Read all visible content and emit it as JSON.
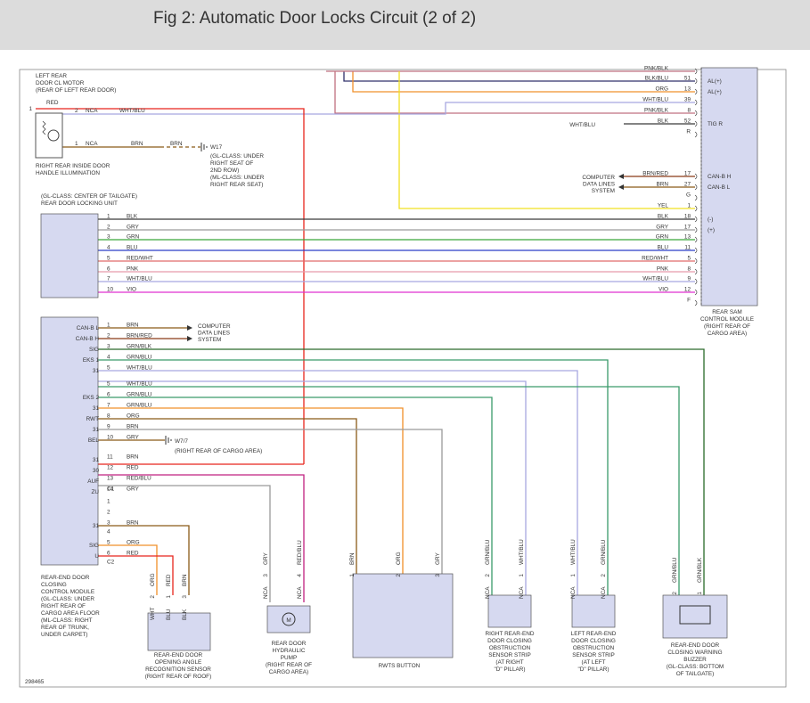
{
  "title": "Fig 2: Automatic Door Locks Circuit (2 of 2)",
  "diagram_id": "298465",
  "colors": {
    "RED": "#e8251c",
    "BLK": "#3a3a3a",
    "GRY": "#9a9a9a",
    "GRN": "#3aa83a",
    "BLU": "#2b3fc6",
    "PNK": "#e89aaa",
    "VIO": "#e030d0",
    "BRN": "#8a5a18",
    "ORG": "#f0902a",
    "YEL": "#f0e020",
    "WHT/BLU": "#a8a8e0",
    "RED/WHT": "#e06a6a",
    "RED/BLU": "#c02080",
    "GRN/BLU": "#3a9a6a",
    "GRN/BLK": "#2a6a2a",
    "BLK/BLU": "#30306a",
    "BRN/RED": "#8a3a18",
    "PNK/BLK": "#c07080"
  },
  "components": {
    "left_rear_motor": "LEFT REAR\nDOOR CL MOTOR\n(REAR OF LEFT REAR DOOR)",
    "handle_illum": "RIGHT REAR INSIDE DOOR\nHANDLE ILLUMINATION",
    "ground_w17": "W17",
    "ground_w17_desc": "(GL-CLASS: UNDER\nRIGHT SEAT OF\n2ND ROW)\n(ML-CLASS: UNDER\nRIGHT REAR SEAT)",
    "tailgate_unit": "(GL-CLASS: CENTER OF TAILGATE)\nREAR DOOR LOCKING UNIT",
    "closing_module": "REAR-END DOOR\nCLOSING\nCONTROL MODULE\n(GL-CLASS: UNDER\nRIGHT REAR OF\nCARGO AREA FLOOR\n(ML-CLASS: RIGHT\nREAR OF TRUNK,\nUNDER CARPET)",
    "angle_sensor": "REAR-END DOOR\nOPENING ANGLE\nRECOGNITION SENSOR\n(RIGHT REAR OF ROOF)",
    "pump": "REAR DOOR\nHYDRAULIC\nPUMP\n(RIGHT REAR OF\nCARGO AREA)",
    "rwts": "RWTS BUTTON",
    "right_strip": "RIGHT REAR-END\nDOOR CLOSING\nOBSTRUCTION\nSENSOR STRIP\n(AT RIGHT\n\"D\" PILLAR)",
    "left_strip": "LEFT REAR-END\nDOOR CLOSING\nOBSTRUCTION\nSENSOR STRIP\n(AT LEFT\n\"D\" PILLAR)",
    "buzzer": "REAR-END DOOR\nCLOSING WARNING\nBUZZER\n(GL-CLASS: BOTTOM\nOF TAILGATE)",
    "sam": "REAR SAM\nCONTROL MODULE\n(RIGHT REAR OF\nCARGO AREA)",
    "computer_lines": "COMPUTER\nDATA LINES\nSYSTEM",
    "ground_w77": "W7/7",
    "ground_w77_desc": "(RIGHT REAR OF CARGO AREA)"
  },
  "sam_pins": [
    {
      "wire": "PNK/BLK",
      "pin": "",
      "sig": ""
    },
    {
      "wire": "BLK/BLU",
      "pin": "51",
      "sig": "AL(+)"
    },
    {
      "wire": "ORG",
      "pin": "13",
      "sig": "AL(+)"
    },
    {
      "wire": "WHT/BLU",
      "pin": "39",
      "sig": ""
    },
    {
      "wire": "PNK/BLK",
      "pin": "8",
      "sig": ""
    },
    {
      "wire": "BLK",
      "pin": "52",
      "sig": "TIG R"
    },
    {
      "wire": "",
      "pin": "R",
      "sig": ""
    },
    {
      "wire": "BRN/RED",
      "pin": "17",
      "sig": "CAN-B H"
    },
    {
      "wire": "BRN",
      "pin": "27",
      "sig": "CAN-B L"
    },
    {
      "wire": "",
      "pin": "G",
      "sig": ""
    },
    {
      "wire": "YEL",
      "pin": "1",
      "sig": ""
    },
    {
      "wire": "BLK",
      "pin": "18",
      "sig": "(-)"
    },
    {
      "wire": "GRY",
      "pin": "17",
      "sig": "(+)"
    },
    {
      "wire": "GRN",
      "pin": "13",
      "sig": ""
    },
    {
      "wire": "BLU",
      "pin": "11",
      "sig": ""
    },
    {
      "wire": "RED/WHT",
      "pin": "5",
      "sig": ""
    },
    {
      "wire": "PNK",
      "pin": "8",
      "sig": ""
    },
    {
      "wire": "WHT/BLU",
      "pin": "9",
      "sig": ""
    },
    {
      "wire": "VIO",
      "pin": "12",
      "sig": ""
    },
    {
      "wire": "",
      "pin": "F",
      "sig": ""
    }
  ],
  "motor_wires": [
    {
      "pin": "1",
      "wire": "RED",
      "sig": ""
    },
    {
      "pin": "2",
      "wire": "WHT/BLU",
      "sig": "NCA"
    },
    {
      "pin": "1",
      "wire": "BRN",
      "sig": "NCA"
    }
  ],
  "tailgate_wires": [
    {
      "pin": "1",
      "wire": "BLK"
    },
    {
      "pin": "2",
      "wire": "GRY"
    },
    {
      "pin": "3",
      "wire": "GRN"
    },
    {
      "pin": "4",
      "wire": "BLU"
    },
    {
      "pin": "5",
      "wire": "RED/WHT"
    },
    {
      "pin": "6",
      "wire": "PNK"
    },
    {
      "pin": "7",
      "wire": "WHT/BLU"
    },
    {
      "pin": "10",
      "wire": "VIO"
    }
  ],
  "module_pins": [
    {
      "sig": "CAN-B L",
      "pin": "1",
      "wire": "BRN"
    },
    {
      "sig": "CAN-B H",
      "pin": "2",
      "wire": "BRN/RED"
    },
    {
      "sig": "SIG",
      "pin": "3",
      "wire": "GRN/BLK"
    },
    {
      "sig": "EKS 1",
      "pin": "4",
      "wire": "GRN/BLU"
    },
    {
      "sig": "31",
      "pin": "5",
      "wire": "WHT/BLU"
    },
    {
      "sig": "",
      "pin": "5",
      "wire": "WHT/BLU"
    },
    {
      "sig": "EKS 2",
      "pin": "6",
      "wire": "GRN/BLU"
    },
    {
      "sig": "31",
      "pin": "7",
      "wire": "GRN/BLU"
    },
    {
      "sig": "RWT",
      "pin": "8",
      "wire": "ORG"
    },
    {
      "sig": "31",
      "pin": "9",
      "wire": "BRN"
    },
    {
      "sig": "BEL",
      "pin": "10",
      "wire": "GRY"
    },
    {
      "sig": "31",
      "pin": "11",
      "wire": "BRN"
    },
    {
      "sig": "30",
      "pin": "12",
      "wire": "RED"
    },
    {
      "sig": "AUF",
      "pin": "13",
      "wire": "RED/BLU"
    },
    {
      "sig": "ZU",
      "pin": "14",
      "wire": "GRY"
    },
    {
      "sig": "",
      "pin": "C1",
      "wire": ""
    }
  ],
  "module_c2_pins": [
    {
      "sig": "",
      "pin": "1",
      "wire": ""
    },
    {
      "sig": "",
      "pin": "2",
      "wire": ""
    },
    {
      "sig": "31",
      "pin": "3",
      "wire": "BRN"
    },
    {
      "sig": "",
      "pin": "4",
      "wire": ""
    },
    {
      "sig": "SIG",
      "pin": "5",
      "wire": "ORG"
    },
    {
      "sig": "U",
      "pin": "6",
      "wire": "RED"
    },
    {
      "sig": "",
      "pin": "C2",
      "wire": ""
    }
  ],
  "device_pins": {
    "angle": [
      {
        "num": "2",
        "wire": "ORG",
        "sig": "WHT"
      },
      {
        "num": "1",
        "wire": "RED",
        "sig": "BLU"
      },
      {
        "num": "3",
        "wire": "BRN",
        "sig": "BLK"
      }
    ],
    "pump": [
      {
        "num": "3",
        "wire": "GRY",
        "sig": "NCA"
      },
      {
        "num": "4",
        "wire": "RED/BLU",
        "sig": "NCA"
      }
    ],
    "rwts": [
      {
        "num": "1",
        "wire": "BRN",
        "sig": ""
      },
      {
        "num": "2",
        "wire": "ORG",
        "sig": ""
      },
      {
        "num": "3",
        "wire": "GRY",
        "sig": ""
      }
    ],
    "right_strip": [
      {
        "num": "2",
        "wire": "GRN/BLU",
        "sig": "NCA"
      },
      {
        "num": "1",
        "wire": "WHT/BLU",
        "sig": "NCA"
      }
    ],
    "left_strip": [
      {
        "num": "1",
        "wire": "WHT/BLU",
        "sig": "NCA"
      },
      {
        "num": "2",
        "wire": "GRN/BLU",
        "sig": "NCA"
      }
    ],
    "buzzer": [
      {
        "num": "2",
        "wire": "GRN/BLU",
        "sig": ""
      },
      {
        "num": "1",
        "wire": "GRN/BLK",
        "sig": ""
      }
    ]
  }
}
